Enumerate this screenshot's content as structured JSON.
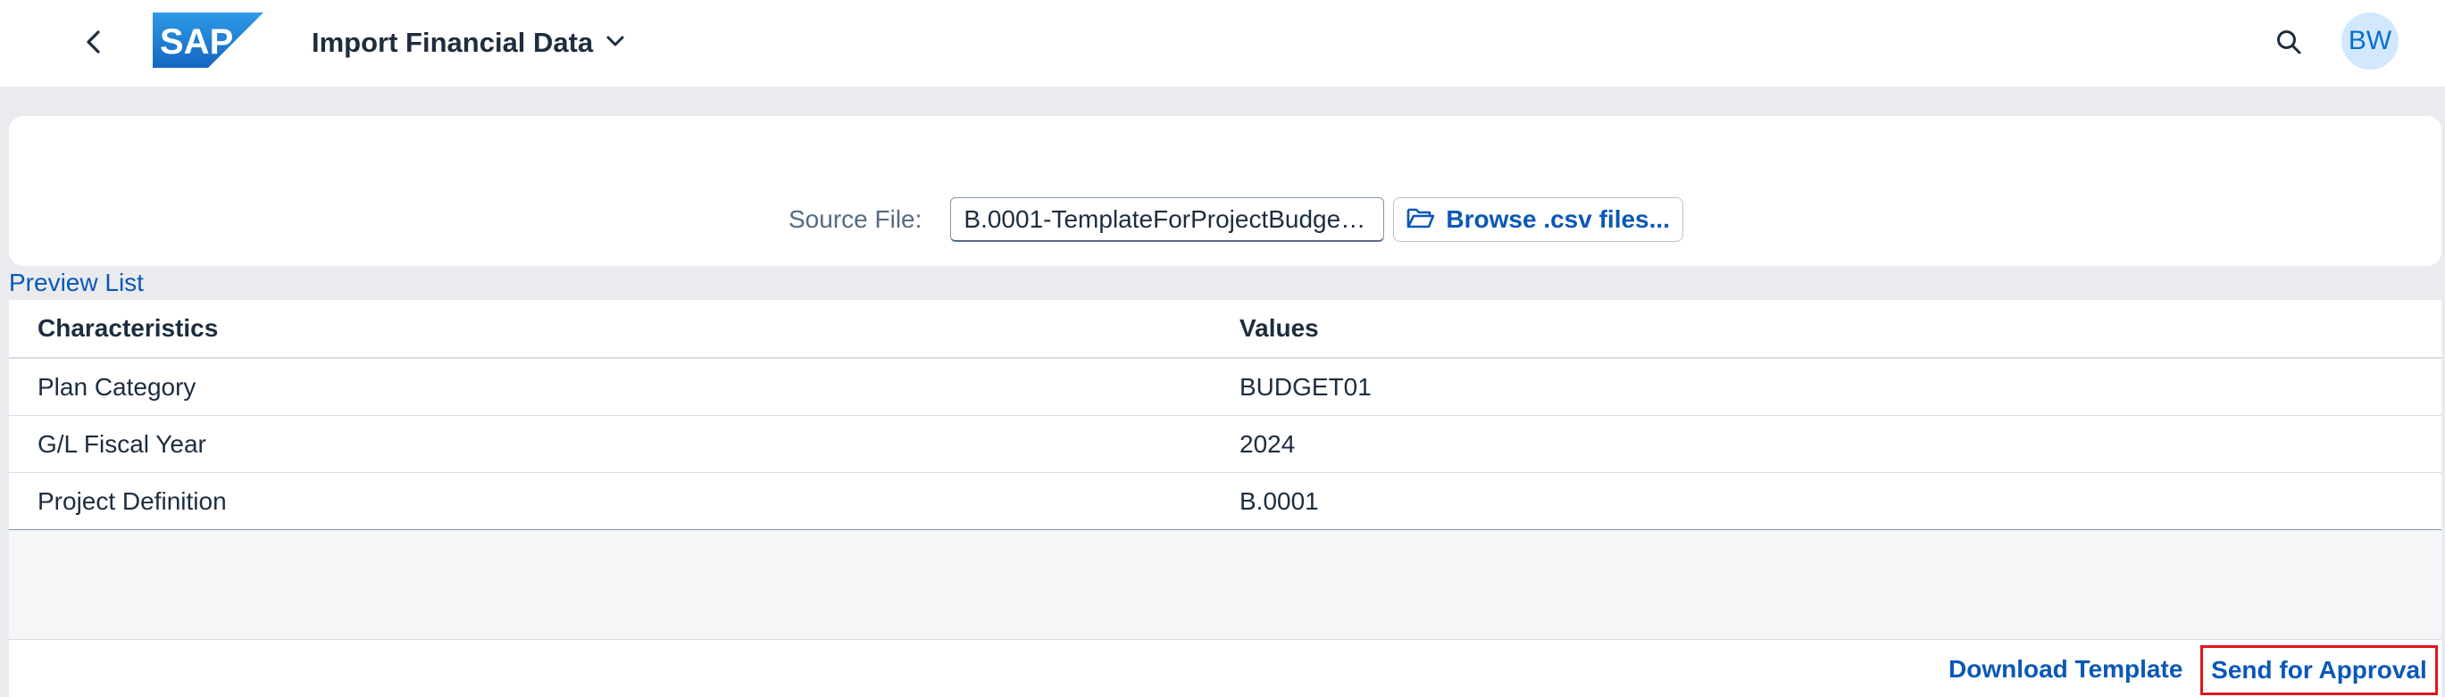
{
  "shell": {
    "title": "Import Financial Data",
    "logo_text": "SAP",
    "avatar_initials": "BW",
    "icons": {
      "back": "chevron-left-icon",
      "title_dropdown": "chevron-down-icon",
      "search": "search-icon"
    }
  },
  "source": {
    "label": "Source File:",
    "file_value": "B.0001-TemplateForProjectBudgeti...",
    "browse_label": "Browse .csv files...",
    "browse_icon": "folder-open-icon"
  },
  "preview": {
    "title": "Preview List",
    "columns": [
      "Characteristics",
      "Values"
    ],
    "rows": [
      [
        "Plan Category",
        "BUDGET01"
      ],
      [
        "G/L Fiscal Year",
        "2024"
      ],
      [
        "Project Definition",
        "B.0001"
      ]
    ]
  },
  "footer": {
    "download_label": "Download Template",
    "send_label": "Send for Approval"
  },
  "colors": {
    "accent": "#0a58b8",
    "highlight_border": "#e0151c",
    "logo_blue": "#1a73c9"
  }
}
